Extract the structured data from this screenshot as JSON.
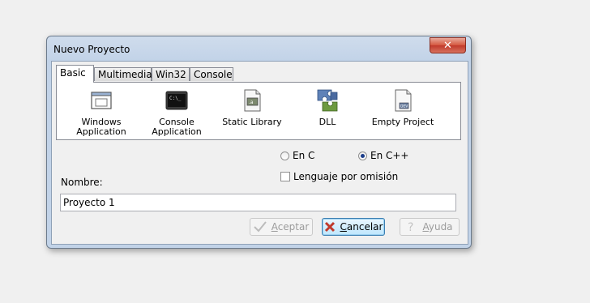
{
  "window": {
    "title": "Nuevo Proyecto"
  },
  "tabs": [
    {
      "label": "Basic",
      "active": true
    },
    {
      "label": "Multimedia",
      "active": false
    },
    {
      "label": "Win32",
      "active": false
    },
    {
      "label": "Console",
      "active": false
    }
  ],
  "project_types": [
    {
      "line1": "Windows",
      "line2": "Application",
      "icon": "windows-application-icon"
    },
    {
      "line1": "Console",
      "line2": "Application",
      "icon": "console-application-icon"
    },
    {
      "line1": "Static Library",
      "line2": "",
      "icon": "static-library-icon"
    },
    {
      "line1": "DLL",
      "line2": "",
      "icon": "dll-icon"
    },
    {
      "line1": "Empty Project",
      "line2": "",
      "icon": "empty-project-icon"
    }
  ],
  "language": {
    "c_label": "En C",
    "cpp_label": "En C++",
    "selected": "cpp",
    "default_label": "Lenguaje por omisión",
    "default_checked": false
  },
  "name": {
    "label": "Nombre:",
    "value": "Proyecto 1"
  },
  "buttons": {
    "accept_first": "A",
    "accept_rest": "ceptar",
    "cancel_first": "C",
    "cancel_rest": "ancelar",
    "help_first": "A",
    "help_rest": "yuda"
  },
  "colors": {
    "accent": "#3c7fb1",
    "close": "#c0392b"
  }
}
